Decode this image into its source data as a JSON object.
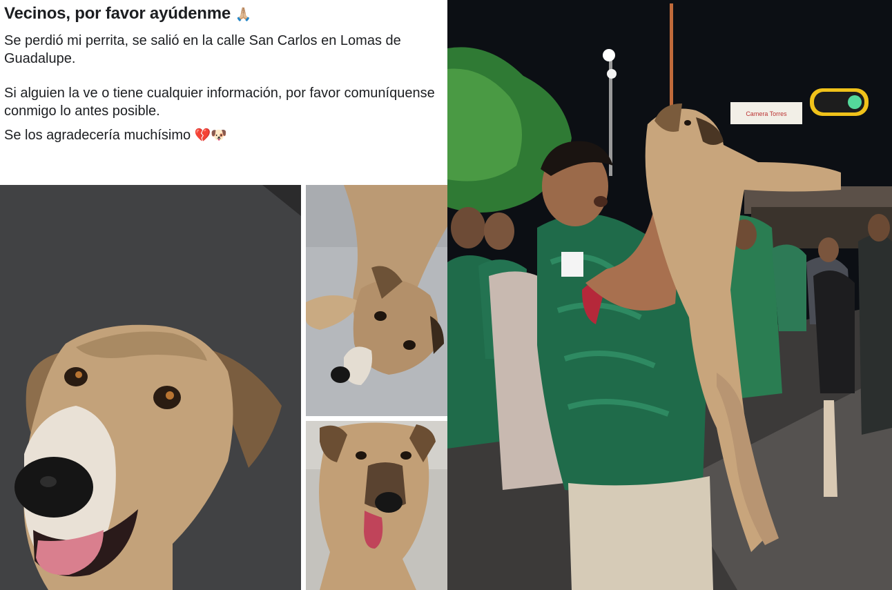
{
  "post": {
    "title": "Vecinos, por favor ayúdenme",
    "title_emoji": "🙏🏼",
    "paragraph_1": "Se perdió mi perrita, se salió en la calle San Carlos en Lomas de Guadalupe.",
    "paragraph_2": "Si alguien la ve o tiene cualquier información, por favor comuníquense conmigo lo antes posible.",
    "paragraph_3": "Se los agradecería muchísimo",
    "paragraph_3_emojis": "💔🐶"
  },
  "photos": {
    "street_sign_text": "Camera Torres"
  },
  "colors": {
    "text": "#1c1e21",
    "jersey_green": "#1f6b4a",
    "dog_tan": "#c8a57c",
    "night_sky": "#0c0f14"
  }
}
